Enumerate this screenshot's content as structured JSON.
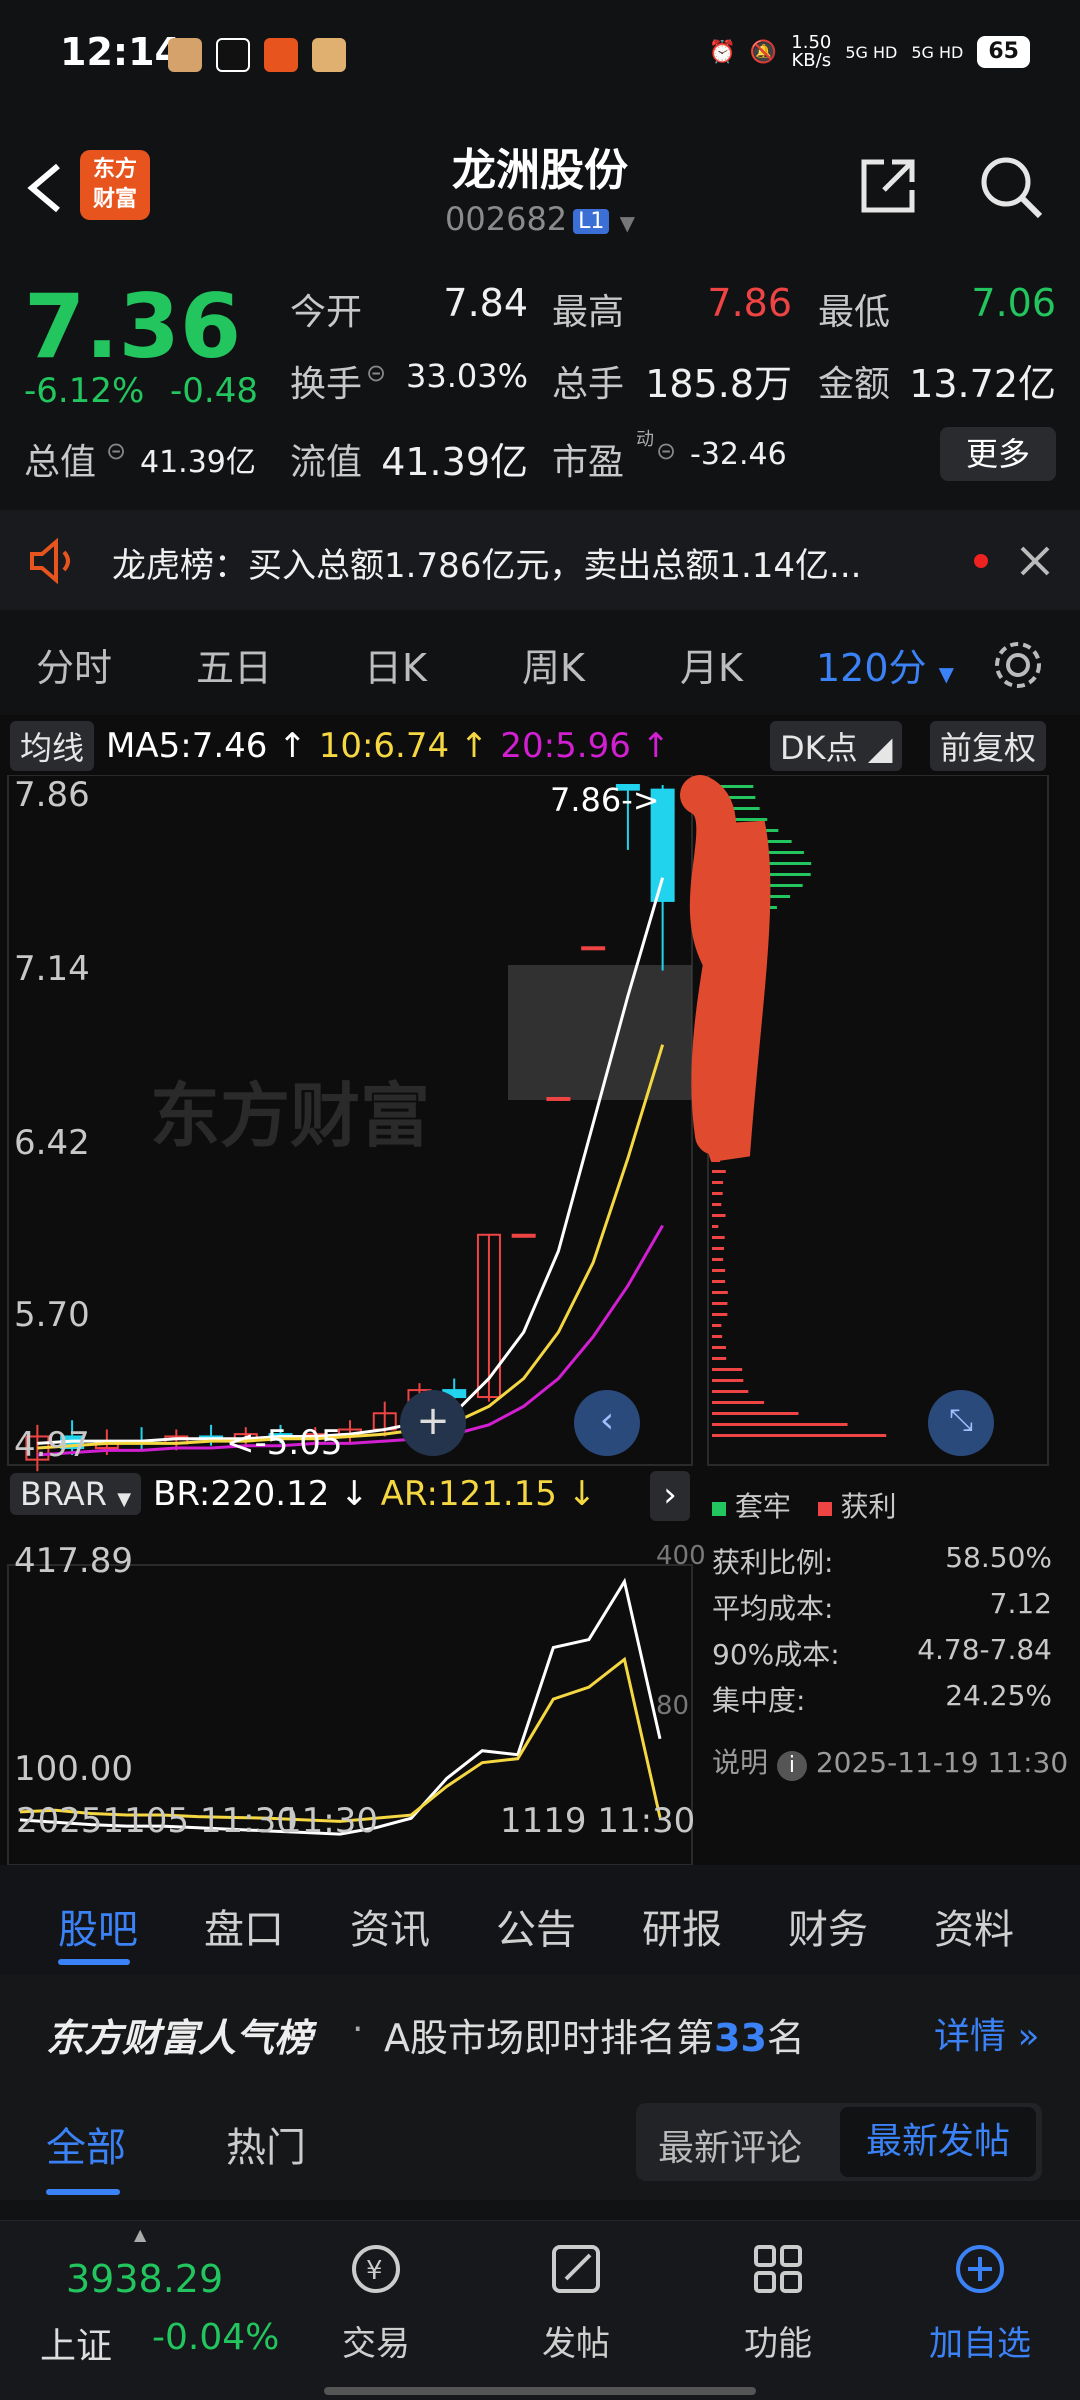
{
  "status": {
    "time": "12:14",
    "net_speed_top": "1.50",
    "net_speed_unit": "KB/s",
    "signal1": "5G HD",
    "signal2": "5G HD",
    "battery": "65"
  },
  "header": {
    "logo_line1": "东方",
    "logo_line2": "财富",
    "name": "龙洲股份",
    "code": "002682",
    "level": "L1"
  },
  "quote": {
    "price": "7.36",
    "change_pct": "-6.12%",
    "change": "-0.48",
    "open_label": "今开",
    "open": "7.84",
    "high_label": "最高",
    "high": "7.86",
    "low_label": "最低",
    "low": "7.06",
    "turnover_label": "换手",
    "turnover": "33.03%",
    "volume_label": "总手",
    "volume": "185.8万",
    "amount_label": "金额",
    "amount": "13.72亿",
    "mcap_label": "总值",
    "mcap": "41.39亿",
    "float_label": "流值",
    "float": "41.39亿",
    "pe_label": "市盈",
    "pe_sup": "动",
    "pe": "-32.46",
    "more": "更多"
  },
  "news": {
    "text": "龙虎榜：买入总额1.786亿元，卖出总额1.14亿..."
  },
  "periods": {
    "tabs": [
      "分时",
      "五日",
      "日K",
      "周K",
      "月K"
    ],
    "active": "120分"
  },
  "chart": {
    "ma_label": "均线",
    "ma5": "MA5:7.46 ↑",
    "ma10": "10:6.74 ↑",
    "ma20": "20:5.96 ↑",
    "dk": "DK点",
    "fq": "前复权",
    "yticks": [
      "7.86",
      "7.14",
      "6.42",
      "5.70",
      "4.97"
    ],
    "high_mark": "7.86",
    "low_mark": "<-5.05",
    "watermark": "东方财富",
    "ind_name": "BRAR",
    "br": "BR:220.12 ↓",
    "ar": "AR:121.15 ↓",
    "ind_ymax": "417.89",
    "ind_ymin": "100.00",
    "ind_r400": "400",
    "ind_r80": "80",
    "date_left": "20251105 11:30",
    "date_mid": "11:30",
    "date_right": "1119 11:30",
    "colors": {
      "ma5": "#ffffff",
      "ma10": "#f5d742",
      "ma20": "#d21fd2",
      "up": "#ef4444",
      "down": "#22d3ee"
    }
  },
  "chart_data": {
    "type": "candlestick",
    "y_range": [
      4.97,
      7.86
    ],
    "candles": [
      {
        "o": 4.95,
        "h": 5.1,
        "l": 4.9,
        "c": 5.05
      },
      {
        "o": 5.05,
        "h": 5.12,
        "l": 4.97,
        "c": 5.0
      },
      {
        "o": 5.0,
        "h": 5.08,
        "l": 4.97,
        "c": 5.03
      },
      {
        "o": 5.03,
        "h": 5.09,
        "l": 4.99,
        "c": 5.02
      },
      {
        "o": 5.02,
        "h": 5.08,
        "l": 4.99,
        "c": 5.05
      },
      {
        "o": 5.05,
        "h": 5.1,
        "l": 5.01,
        "c": 5.04
      },
      {
        "o": 5.04,
        "h": 5.09,
        "l": 5.0,
        "c": 5.06
      },
      {
        "o": 5.06,
        "h": 5.1,
        "l": 5.02,
        "c": 5.05
      },
      {
        "o": 5.05,
        "h": 5.09,
        "l": 5.01,
        "c": 5.06
      },
      {
        "o": 5.06,
        "h": 5.12,
        "l": 5.02,
        "c": 5.08
      },
      {
        "o": 5.08,
        "h": 5.2,
        "l": 5.05,
        "c": 5.15
      },
      {
        "o": 5.15,
        "h": 5.28,
        "l": 5.12,
        "c": 5.25
      },
      {
        "o": 5.25,
        "h": 5.3,
        "l": 5.18,
        "c": 5.22
      },
      {
        "o": 5.22,
        "h": 5.92,
        "l": 5.2,
        "c": 5.92
      },
      {
        "o": 5.92,
        "h": 5.92,
        "l": 5.92,
        "c": 5.92
      },
      {
        "o": 6.51,
        "h": 6.51,
        "l": 6.51,
        "c": 6.51
      },
      {
        "o": 7.16,
        "h": 7.16,
        "l": 7.16,
        "c": 7.16
      },
      {
        "o": 7.86,
        "h": 7.86,
        "l": 7.58,
        "c": 7.84
      },
      {
        "o": 7.84,
        "h": 7.86,
        "l": 7.06,
        "c": 7.36
      }
    ],
    "ma5": [
      5.02,
      5.03,
      5.03,
      5.03,
      5.04,
      5.04,
      5.04,
      5.05,
      5.05,
      5.06,
      5.08,
      5.11,
      5.15,
      5.3,
      5.5,
      5.85,
      6.4,
      6.95,
      7.46
    ],
    "ma10": [
      5.0,
      5.01,
      5.02,
      5.02,
      5.02,
      5.03,
      5.03,
      5.04,
      5.04,
      5.05,
      5.06,
      5.08,
      5.11,
      5.18,
      5.3,
      5.5,
      5.8,
      6.25,
      6.74
    ],
    "ma20": [
      4.97,
      4.98,
      4.99,
      4.99,
      5.0,
      5.0,
      5.01,
      5.01,
      5.02,
      5.02,
      5.03,
      5.04,
      5.06,
      5.1,
      5.18,
      5.3,
      5.48,
      5.7,
      5.96
    ],
    "br": [
      118,
      115,
      112,
      110,
      110,
      108,
      106,
      104,
      102,
      100,
      108,
      120,
      170,
      205,
      200,
      335,
      345,
      418,
      220
    ],
    "ar": [
      128,
      130,
      126,
      124,
      124,
      122,
      121,
      120,
      118,
      116,
      120,
      124,
      160,
      190,
      195,
      270,
      285,
      320,
      121
    ]
  },
  "chips": {
    "legend_trap": "套牢",
    "legend_profit": "获利",
    "rows": [
      {
        "label": "获利比例:",
        "value": "58.50%"
      },
      {
        "label": "平均成本:",
        "value": "7.12"
      },
      {
        "label": "90%成本:",
        "value": "4.78-7.84"
      },
      {
        "label": "集中度:",
        "value": "24.25%"
      }
    ],
    "note": "说明",
    "note_time": "2025-11-19 11:30"
  },
  "ftabs": [
    "股吧",
    "盘口",
    "资讯",
    "公告",
    "研报",
    "财务",
    "资料"
  ],
  "rank": {
    "brand": "东方财富人气榜",
    "dot": "·",
    "text_pre": "A股市场即时排名第",
    "rank": "33",
    "text_post": "名",
    "details": "详情"
  },
  "sub": {
    "all": "全部",
    "hot": "热门",
    "latest_comment": "最新评论",
    "latest_post": "最新发帖"
  },
  "bottomnav": {
    "index_value": "3938.29",
    "index_name": "上证",
    "index_change": "-0.04%",
    "items": [
      "交易",
      "发帖",
      "功能",
      "加自选"
    ]
  }
}
